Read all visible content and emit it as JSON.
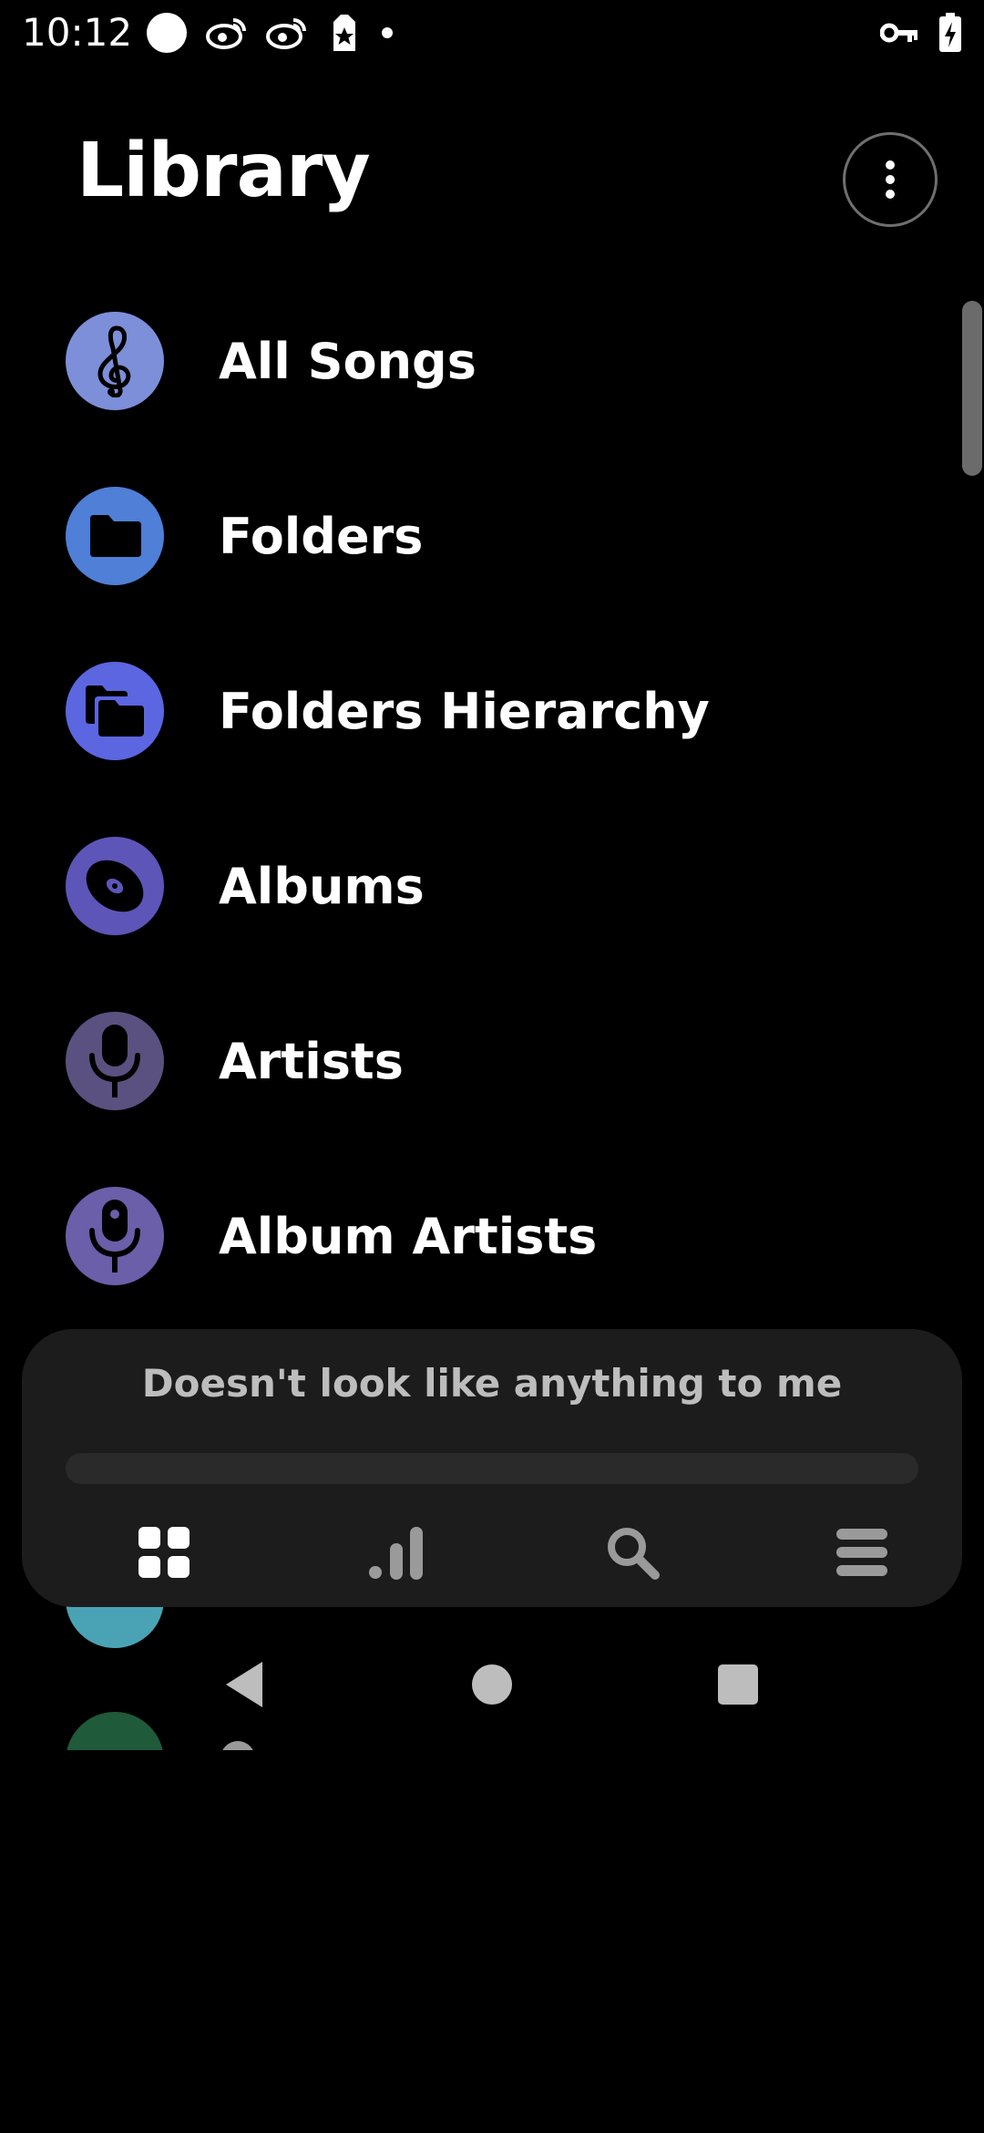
{
  "status_bar": {
    "time": "10:12",
    "left_icons": [
      "circle-notification-icon",
      "weibo-icon",
      "weibo-icon",
      "star-tag-icon",
      "dot-icon"
    ],
    "right_icons": [
      "vpn-key-icon",
      "battery-charging-icon"
    ]
  },
  "header": {
    "title": "Library",
    "overflow_icon": "more-vertical-icon"
  },
  "library": {
    "items": [
      {
        "label": "All Songs",
        "icon": "treble-clef-icon",
        "color": "#7d8fd8"
      },
      {
        "label": "Folders",
        "icon": "folder-icon",
        "color": "#4f7fd6"
      },
      {
        "label": "Folders Hierarchy",
        "icon": "folders-hierarchy-icon",
        "color": "#5b66e0"
      },
      {
        "label": "Albums",
        "icon": "disc-icon",
        "color": "#5d55b8"
      },
      {
        "label": "Artists",
        "icon": "microphone-icon",
        "color": "#5a5180"
      },
      {
        "label": "Album Artists",
        "icon": "podcast-microphone-icon",
        "color": "#6a5fa8"
      }
    ]
  },
  "player": {
    "track_title": "Doesn't look like anything to me",
    "progress": 0,
    "nav": [
      {
        "name": "library-tab",
        "icon": "grid-icon",
        "active": true
      },
      {
        "name": "charts-tab",
        "icon": "bar-chart-icon",
        "active": false
      },
      {
        "name": "search-tab",
        "icon": "search-icon",
        "active": false
      },
      {
        "name": "menu-tab",
        "icon": "menu-icon",
        "active": false
      }
    ]
  },
  "system_nav": {
    "buttons": [
      "back-icon",
      "home-icon",
      "recents-icon"
    ]
  },
  "colors": {
    "background": "#000000",
    "panel": "#1c1c1c",
    "text": "#ffffff",
    "muted_text": "#bdbdbd"
  }
}
